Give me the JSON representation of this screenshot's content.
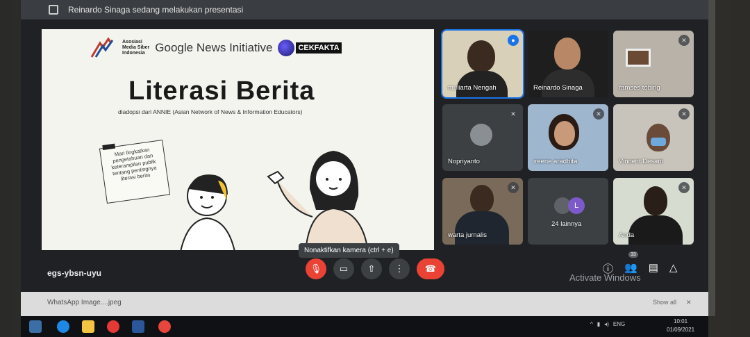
{
  "window": {
    "presenting_text": "Reinardo Sinaga sedang melakukan presentasi"
  },
  "slide": {
    "logo_amsi_text": [
      "Asosiasi",
      "Media Siber",
      "Indonesia"
    ],
    "logo_gni_text": "Google News Initiative",
    "logo_cek_text": "CEKFAKTA",
    "title": "Literasi Berita",
    "subtitle": "diadopsi dari ANNIE (Asian Network of News & Information Educators)",
    "note_text": "Mari tingkatkan pengetahuan dan keterampilan publik tentang pentingnya literasi berita"
  },
  "tooltip": "Nonaktifkan kamera (ctrl + e)",
  "participants": [
    {
      "name": "muliarta Nengah",
      "mic": "speaking"
    },
    {
      "name": "Reinardo Sinaga",
      "mic": "none"
    },
    {
      "name": "ramses tobing",
      "mic": "muted"
    },
    {
      "name": "Nopriyanto",
      "mic": "muted"
    },
    {
      "name": "ireene aradhita",
      "mic": "muted"
    },
    {
      "name": "Vincent Desani",
      "mic": "muted"
    },
    {
      "name": "warta jurnalis",
      "mic": "muted"
    },
    {
      "name": "24 lainnya",
      "mic": "none"
    },
    {
      "name": "Anda",
      "mic": "muted"
    }
  ],
  "others_avatar_letter": "L",
  "meeting_code": "egs-ybsn-uyu",
  "people_count": "33",
  "watermark": "Activate Windows",
  "download": {
    "file": "WhatsApp Image....jpeg",
    "show_all": "Show all"
  },
  "taskbar": {
    "lang": "ENG",
    "time": "10:01",
    "date": "01/09/2021"
  },
  "colors": {
    "accent": "#1a73e8",
    "danger": "#ea4335",
    "bg": "#202124"
  }
}
